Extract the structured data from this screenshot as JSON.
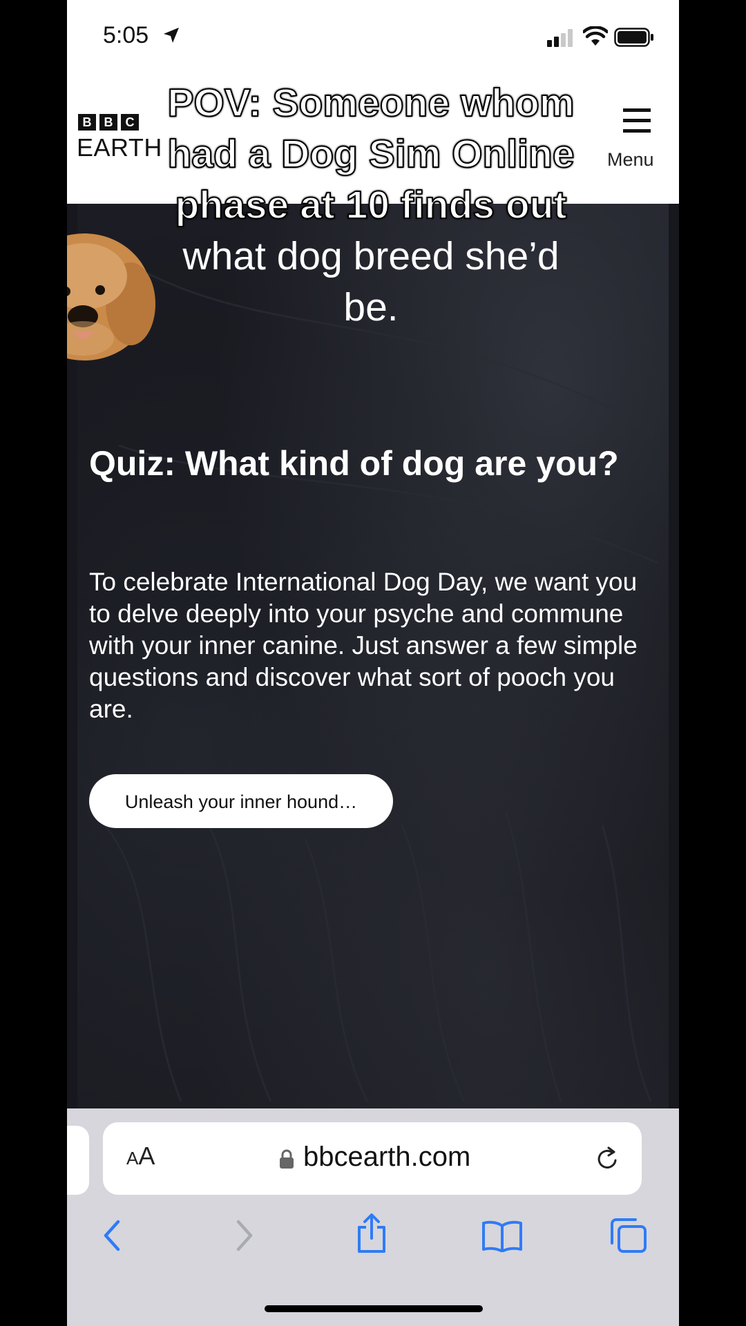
{
  "status_bar": {
    "time": "5:05",
    "icons": [
      "location-arrow-icon",
      "cellular-signal-icon",
      "wifi-icon",
      "battery-icon"
    ]
  },
  "site_header": {
    "logo_boxes": [
      "B",
      "B",
      "C"
    ],
    "logo_text": "EARTH",
    "menu_label": "Menu",
    "menu_icon": "hamburger-icon"
  },
  "overlay": {
    "caption_lines": [
      "POV: Someone whom",
      "had a Dog Sim Online",
      "phase at 10 finds out",
      "what dog breed she’d",
      "be."
    ]
  },
  "content": {
    "title": "Quiz: What kind of dog are you?",
    "body": "To celebrate International Dog Day, we want you to delve deeply into your psyche and commune with your inner canine. Just answer a few simple questions and discover what sort of pooch you are.",
    "cta_label": "Unleash your inner hound…"
  },
  "browser": {
    "text_size_label_small": "A",
    "text_size_label_big": "A",
    "url": "bbcearth.com",
    "toolbar_icons": [
      "back-icon",
      "forward-icon",
      "share-icon",
      "bookmarks-icon",
      "tabs-icon"
    ]
  },
  "colors": {
    "page_background": "#17181d",
    "header_background": "#ffffff",
    "browser_chrome": "#d6d6dc",
    "safari_blue": "#2f7bf6"
  }
}
